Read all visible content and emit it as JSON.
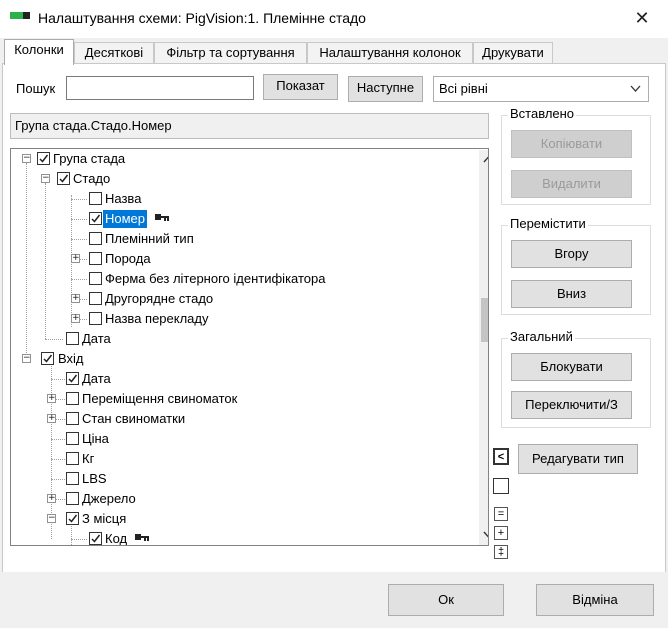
{
  "window": {
    "title": "Налаштування схеми: PigVision:1. Племінне стадо",
    "close_glyph": "✕"
  },
  "tabs": [
    {
      "label": "Колонки",
      "active": true
    },
    {
      "label": "Десяткові",
      "active": false
    },
    {
      "label": "Фільтр та сортування",
      "active": false
    },
    {
      "label": "Налаштування колонок",
      "active": false
    },
    {
      "label": "Друкувати",
      "active": false
    }
  ],
  "search": {
    "label": "Пошук",
    "value": "",
    "show_label": "Показат",
    "next_label": "Наступне",
    "level_value": "Всі рівні"
  },
  "path": "Група стада.Стадо.Номер",
  "tree": [
    {
      "label": "Група стада",
      "checked": true,
      "expander": "minus",
      "selected": false,
      "key": false
    },
    {
      "label": "Стадо",
      "checked": true,
      "expander": "minus",
      "selected": false,
      "key": false
    },
    {
      "label": "Назва",
      "checked": false,
      "expander": "none",
      "selected": false,
      "key": false
    },
    {
      "label": "Номер",
      "checked": true,
      "expander": "none",
      "selected": true,
      "key": true
    },
    {
      "label": "Племінний тип",
      "checked": false,
      "expander": "none",
      "selected": false,
      "key": false
    },
    {
      "label": "Порода",
      "checked": false,
      "expander": "plus",
      "selected": false,
      "key": false
    },
    {
      "label": "Ферма без літерного ідентифікатора",
      "checked": false,
      "expander": "none",
      "selected": false,
      "key": false
    },
    {
      "label": "Другорядне стадо",
      "checked": false,
      "expander": "plus",
      "selected": false,
      "key": false
    },
    {
      "label": "Назва перекладу",
      "checked": false,
      "expander": "plus",
      "selected": false,
      "key": false
    },
    {
      "label": "Дата",
      "checked": false,
      "expander": "none",
      "selected": false,
      "key": false
    },
    {
      "label": "Вхід",
      "checked": true,
      "expander": "minus",
      "selected": false,
      "key": false
    },
    {
      "label": "Дата",
      "checked": true,
      "expander": "none",
      "selected": false,
      "key": false
    },
    {
      "label": "Переміщення свиноматок",
      "checked": false,
      "expander": "plus",
      "selected": false,
      "key": false
    },
    {
      "label": "Стан свиноматки",
      "checked": false,
      "expander": "plus",
      "selected": false,
      "key": false
    },
    {
      "label": "Ціна",
      "checked": false,
      "expander": "none",
      "selected": false,
      "key": false
    },
    {
      "label": "Кг",
      "checked": false,
      "expander": "none",
      "selected": false,
      "key": false
    },
    {
      "label": "LBS",
      "checked": false,
      "expander": "none",
      "selected": false,
      "key": false
    },
    {
      "label": "Джерело",
      "checked": false,
      "expander": "plus",
      "selected": false,
      "key": false
    },
    {
      "label": "З місця",
      "checked": true,
      "expander": "minus",
      "selected": false,
      "key": false
    },
    {
      "label": "Код",
      "checked": true,
      "expander": "none",
      "selected": false,
      "key": true
    }
  ],
  "inserted": {
    "title": "Вставлено",
    "copy_label": "Копіювати",
    "delete_label": "Видалити"
  },
  "move": {
    "title": "Перемістити",
    "up_label": "Вгору",
    "down_label": "Вниз"
  },
  "general": {
    "title": "Загальний",
    "lock_label": "Блокувати",
    "switch_label": "Переключити/З"
  },
  "edit_type_label": "Редагувати тип",
  "side_buttons": {
    "left_glyph": "<",
    "minus_glyph": "=",
    "plus_glyph": "+",
    "plusplus_glyph": "‡"
  },
  "footer": {
    "ok_label": "Ок",
    "cancel_label": "Відміна"
  },
  "icons": {
    "app": "app-logo-icon",
    "key": "key-icon",
    "dropdown": "chevron-down-icon",
    "scroll_up": "chevron-up-icon",
    "scroll_down": "chevron-down-icon"
  },
  "colors": {
    "selection": "#0078d7",
    "logo_green": "#2bb24c"
  }
}
